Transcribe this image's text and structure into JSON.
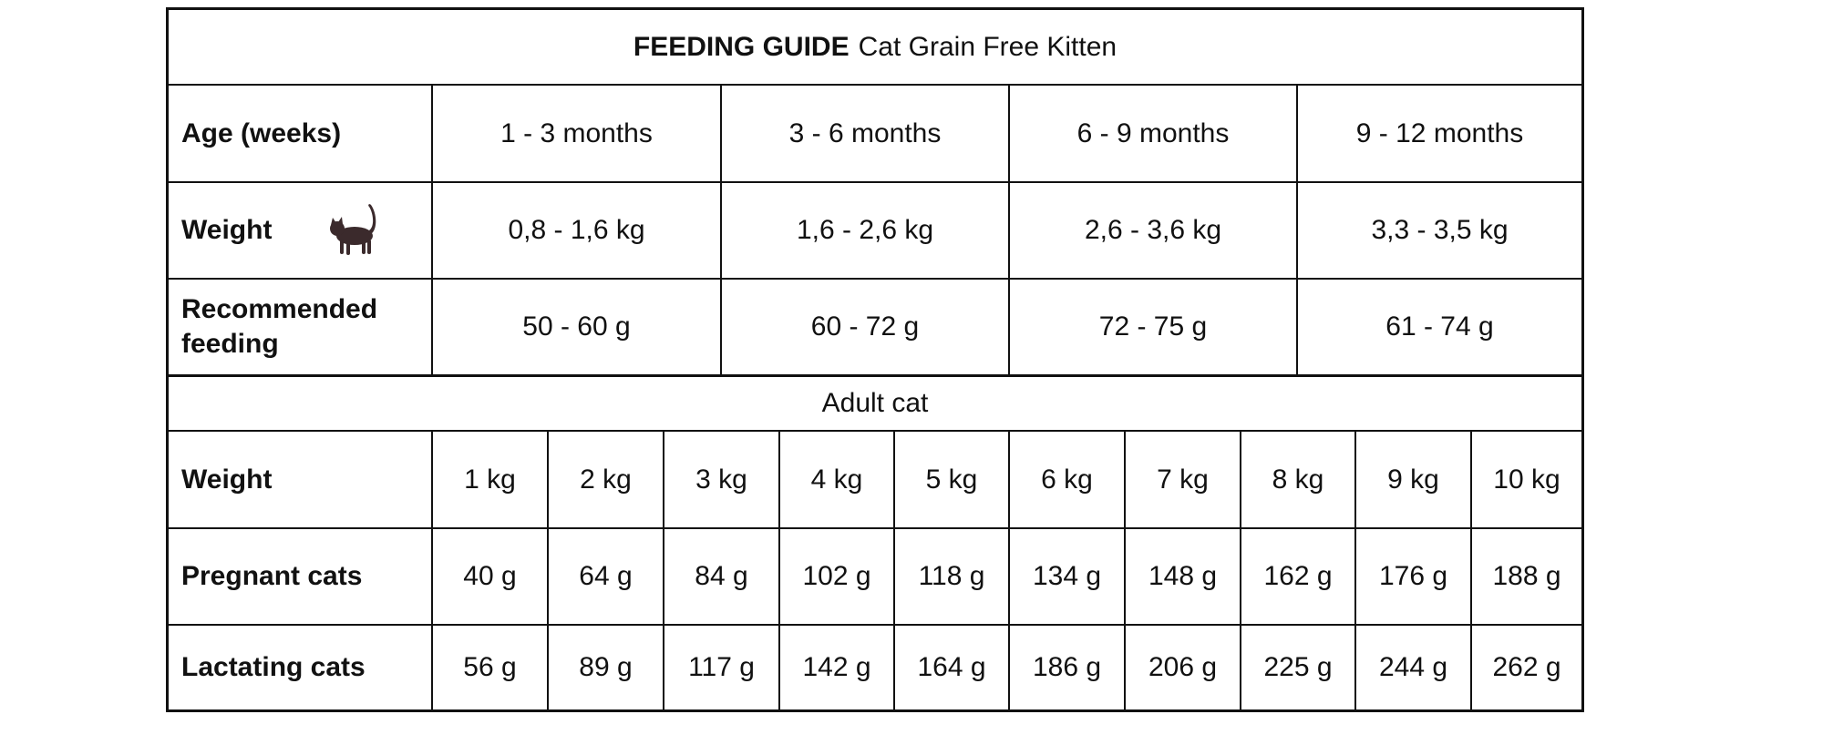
{
  "title": {
    "bold": "FEEDING GUIDE",
    "rest": "Cat Grain Free Kitten"
  },
  "kitten": {
    "age_label": "Age (weeks)",
    "ages": [
      "1 - 3 months",
      "3 - 6 months",
      "6 - 9 months",
      "9 - 12 months"
    ],
    "weight_label": "Weight",
    "weights": [
      "0,8 - 1,6 kg",
      "1,6 - 2,6 kg",
      "2,6 - 3,6 kg",
      "3,3 - 3,5 kg"
    ],
    "feeding_label": "Recommended feeding",
    "feedings": [
      "50 - 60 g",
      "60 - 72 g",
      "72 - 75 g",
      "61 - 74 g"
    ]
  },
  "adult": {
    "section_label": "Adult cat",
    "weight_label": "Weight",
    "weights": [
      "1 kg",
      "2 kg",
      "3 kg",
      "4 kg",
      "5 kg",
      "6 kg",
      "7 kg",
      "8 kg",
      "9 kg",
      "10 kg"
    ],
    "pregnant_label": "Pregnant cats",
    "pregnant": [
      "40 g",
      "64 g",
      "84 g",
      "102 g",
      "118 g",
      "134 g",
      "148 g",
      "162 g",
      "176 g",
      "188 g"
    ],
    "lactating_label": "Lactating cats",
    "lactating": [
      "56 g",
      "89 g",
      "117 g",
      "142 g",
      "164 g",
      "186 g",
      "206 g",
      "225 g",
      "244 g",
      "262 g"
    ]
  },
  "icons": {
    "weight_icon": "cat-silhouette-icon"
  },
  "colors": {
    "border": "#111111",
    "icon": "#3b2a2c"
  }
}
